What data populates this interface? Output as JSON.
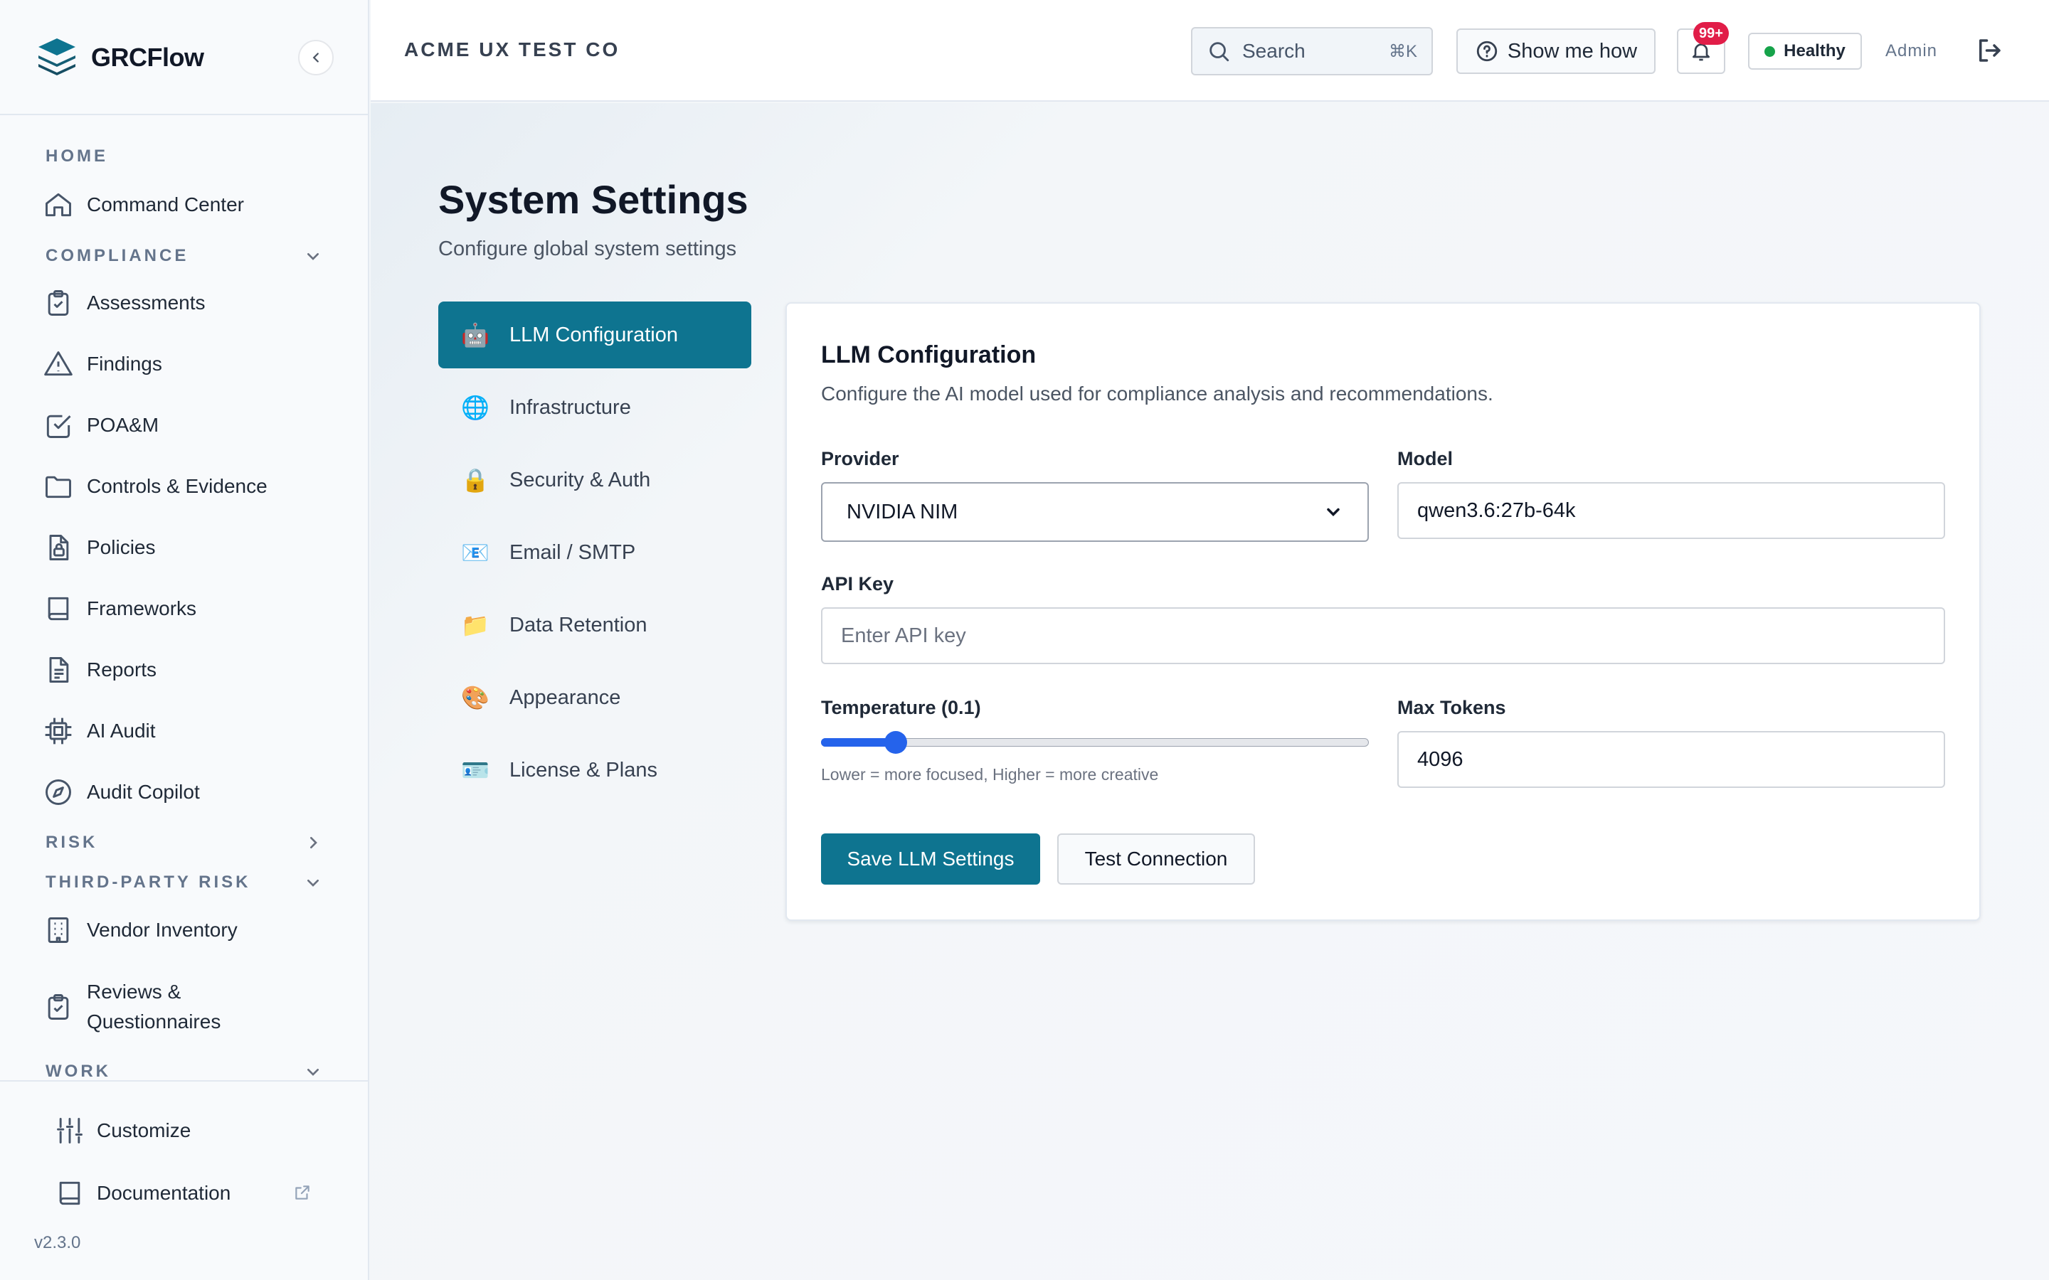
{
  "app": {
    "name": "GRCFlow",
    "version": "v2.3.0"
  },
  "header": {
    "org_name": "ACME UX TEST CO",
    "search_placeholder": "Search",
    "search_shortcut": "⌘K",
    "help_label": "Show me how",
    "notification_count": "99+",
    "health_status": "Healthy",
    "user_role": "Admin"
  },
  "sidebar": {
    "sections": {
      "home": "HOME",
      "compliance": "COMPLIANCE",
      "risk": "RISK",
      "third_party_risk": "THIRD-PARTY RISK",
      "work": "WORK"
    },
    "items": {
      "command_center": "Command Center",
      "assessments": "Assessments",
      "findings": "Findings",
      "poam": "POA&M",
      "controls_evidence": "Controls & Evidence",
      "policies": "Policies",
      "frameworks": "Frameworks",
      "reports": "Reports",
      "ai_audit": "AI Audit",
      "audit_copilot": "Audit Copilot",
      "vendor_inventory": "Vendor Inventory",
      "reviews_questionnaires_line1": "Reviews &",
      "reviews_questionnaires_line2": "Questionnaires"
    },
    "footer": {
      "customize": "Customize",
      "documentation": "Documentation"
    }
  },
  "page": {
    "title": "System Settings",
    "subtitle": "Configure global system settings"
  },
  "settings_tabs": [
    {
      "label": "LLM Configuration",
      "icon": "🤖",
      "active": true
    },
    {
      "label": "Infrastructure",
      "icon": "🌐"
    },
    {
      "label": "Security & Auth",
      "icon": "🔒"
    },
    {
      "label": "Email / SMTP",
      "icon": "📧"
    },
    {
      "label": "Data Retention",
      "icon": "📁"
    },
    {
      "label": "Appearance",
      "icon": "🎨"
    },
    {
      "label": "License & Plans",
      "icon": "🪪"
    }
  ],
  "llm_config": {
    "title": "LLM Configuration",
    "description": "Configure the AI model used for compliance analysis and recommendations.",
    "provider_label": "Provider",
    "provider_value": "NVIDIA NIM",
    "model_label": "Model",
    "model_value": "qwen3.6:27b-64k",
    "api_key_label": "API Key",
    "api_key_placeholder": "Enter API key",
    "temperature_label": "Temperature (0.1)",
    "temperature_value": 0.1,
    "temperature_hint": "Lower = more focused, Higher = more creative",
    "max_tokens_label": "Max Tokens",
    "max_tokens_value": "4096",
    "save_button": "Save LLM Settings",
    "test_button": "Test Connection"
  },
  "colors": {
    "accent": "#0e7490",
    "status_ok": "#16a34a",
    "badge": "#e11d48",
    "slider": "#2563eb"
  }
}
